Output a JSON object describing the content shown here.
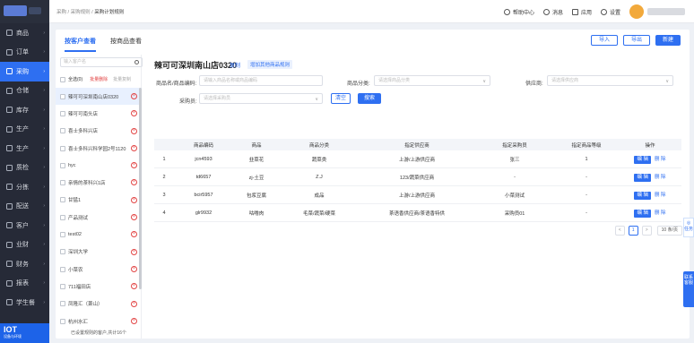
{
  "colors": {
    "accent": "#2e6ff1",
    "sidebar_bg": "#262a37",
    "danger": "#e24545"
  },
  "breadcrumb": [
    "采购",
    "采购规则",
    "采购计划规则"
  ],
  "topbar": {
    "help": "帮助中心",
    "messages": "消息",
    "apps": "应用",
    "settings": "设置"
  },
  "sidebar": {
    "items": [
      {
        "label": "商品",
        "icon": "grid-icon"
      },
      {
        "label": "订单",
        "icon": "doc-icon"
      },
      {
        "label": "采购",
        "icon": "cart-icon",
        "active": true
      },
      {
        "label": "仓储",
        "icon": "warehouse-icon"
      },
      {
        "label": "库存",
        "icon": "box-icon"
      },
      {
        "label": "生产",
        "icon": "factory-icon"
      },
      {
        "label": "生产",
        "icon": "factory-icon"
      },
      {
        "label": "质检",
        "icon": "check-icon"
      },
      {
        "label": "分拣",
        "icon": "sort-icon"
      },
      {
        "label": "配送",
        "icon": "truck-icon"
      },
      {
        "label": "客户",
        "icon": "user-icon"
      },
      {
        "label": "业财",
        "icon": "money-icon"
      },
      {
        "label": "财务",
        "icon": "finance-icon"
      },
      {
        "label": "报表",
        "icon": "report-icon"
      },
      {
        "label": "学生餐",
        "icon": "meal-icon"
      }
    ],
    "iot_title": "IOT",
    "iot_sub": "设备与环境"
  },
  "tabs": [
    "按客户查看",
    "按商品查看"
  ],
  "actions": {
    "import": "导入",
    "export": "导出",
    "new": "新建"
  },
  "left_panel": {
    "search_placeholder": "输入客户名",
    "select_all": "全选(0)",
    "batch_delete": "批量删除",
    "batch_copy": "批量复制",
    "customers": [
      "辣可可深圳南山店0320",
      "辣可可南头店",
      "喜士多科兴店",
      "喜士多科兴科学园2号1120",
      "hyc",
      "亲情的茶科兴1店",
      "甘猛1",
      "产品测试",
      "test02",
      "深圳大学",
      "小菜农",
      "711福田店",
      "凤隆汇（萧山）",
      "杭州水汇"
    ],
    "footer": "已设置规则的客户,共计16个"
  },
  "main": {
    "title": "辣可可深圳南山店0320",
    "copy": "复制",
    "add_rule": "增加其他商品规则",
    "filters": {
      "name_label": "商品名/商品编码:",
      "name_placeholder": "请输入商品名称或商品编码",
      "category_label": "商品分类:",
      "category_placeholder": "请选择商品分类",
      "supplier_label": "供应商:",
      "supplier_placeholder": "请选择供应商",
      "buyer_label": "采购员:",
      "buyer_placeholder": "请选择采购员",
      "clear": "清空",
      "search": "搜索"
    },
    "table": {
      "headers": [
        "",
        "商品编码",
        "商品",
        "商品分类",
        "指定供应商",
        "指定采购员",
        "指定商品等级",
        "操作"
      ],
      "rows": [
        [
          "1",
          "jcn4593",
          "韭菜花",
          "蔬菜类",
          "上游/上游供应商",
          "张三",
          "1"
        ],
        [
          "2",
          "td6657",
          "zj-土豆",
          "Z.J",
          "123/蔬菜供应商",
          "-",
          "-"
        ],
        [
          "3",
          "bcir5957",
          "包浆豆腐",
          "成品",
          "上游/上游供应商",
          "小菜测试",
          "-"
        ],
        [
          "4",
          "glr9932",
          "咕噜肉",
          "毛菜/蔬菜/硬菜",
          "茶语香供应商/茶语香特供",
          "采购员01",
          "-"
        ]
      ],
      "edit": "编 辑",
      "delete": "删 除"
    },
    "pagination": {
      "prev": "<",
      "current": "1",
      "next": ">",
      "size": "10 条/页"
    }
  },
  "floaters": {
    "task": "任务",
    "contact": "联系客服"
  }
}
